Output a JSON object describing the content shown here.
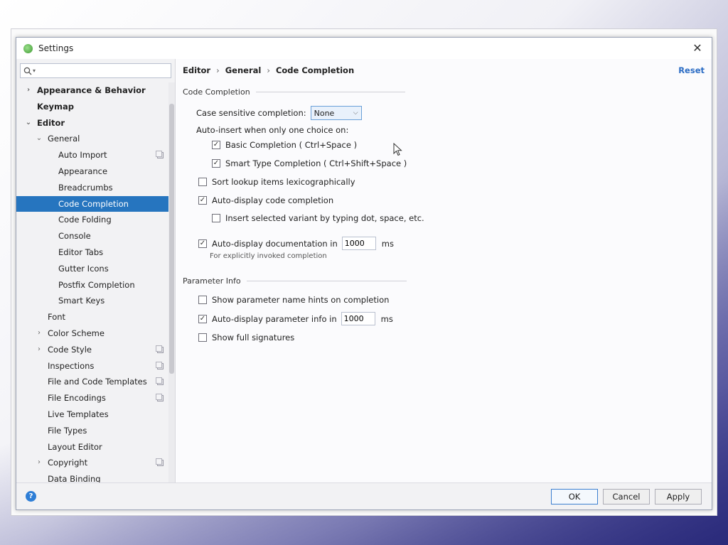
{
  "window": {
    "title": "Settings",
    "close_glyph": "✕",
    "app_icon": "intellij-app-icon"
  },
  "search": {
    "value": "",
    "placeholder": ""
  },
  "tree": [
    {
      "label": "Appearance & Behavior",
      "bold": true,
      "arrow": "›",
      "level": 0
    },
    {
      "label": "Keymap",
      "bold": true,
      "arrow": "",
      "level": 0
    },
    {
      "label": "Editor",
      "bold": true,
      "arrow": "⌄",
      "level": 0
    },
    {
      "label": "General",
      "bold": false,
      "arrow": "⌄",
      "level": 1
    },
    {
      "label": "Auto Import",
      "bold": false,
      "arrow": "",
      "level": 2,
      "copy": true
    },
    {
      "label": "Appearance",
      "bold": false,
      "arrow": "",
      "level": 2
    },
    {
      "label": "Breadcrumbs",
      "bold": false,
      "arrow": "",
      "level": 2
    },
    {
      "label": "Code Completion",
      "bold": false,
      "arrow": "",
      "level": 2,
      "selected": true
    },
    {
      "label": "Code Folding",
      "bold": false,
      "arrow": "",
      "level": 2
    },
    {
      "label": "Console",
      "bold": false,
      "arrow": "",
      "level": 2
    },
    {
      "label": "Editor Tabs",
      "bold": false,
      "arrow": "",
      "level": 2
    },
    {
      "label": "Gutter Icons",
      "bold": false,
      "arrow": "",
      "level": 2
    },
    {
      "label": "Postfix Completion",
      "bold": false,
      "arrow": "",
      "level": 2
    },
    {
      "label": "Smart Keys",
      "bold": false,
      "arrow": "",
      "level": 2
    },
    {
      "label": "Font",
      "bold": false,
      "arrow": "",
      "level": 1
    },
    {
      "label": "Color Scheme",
      "bold": false,
      "arrow": "›",
      "level": 1
    },
    {
      "label": "Code Style",
      "bold": false,
      "arrow": "›",
      "level": 1,
      "copy": true
    },
    {
      "label": "Inspections",
      "bold": false,
      "arrow": "",
      "level": 1,
      "copy": true
    },
    {
      "label": "File and Code Templates",
      "bold": false,
      "arrow": "",
      "level": 1,
      "copy": true
    },
    {
      "label": "File Encodings",
      "bold": false,
      "arrow": "",
      "level": 1,
      "copy": true
    },
    {
      "label": "Live Templates",
      "bold": false,
      "arrow": "",
      "level": 1
    },
    {
      "label": "File Types",
      "bold": false,
      "arrow": "",
      "level": 1
    },
    {
      "label": "Layout Editor",
      "bold": false,
      "arrow": "",
      "level": 1
    },
    {
      "label": "Copyright",
      "bold": false,
      "arrow": "›",
      "level": 1,
      "copy": true
    },
    {
      "label": "Data Binding",
      "bold": false,
      "arrow": "",
      "level": 1
    }
  ],
  "breadcrumb": {
    "items": [
      "Editor",
      "General",
      "Code Completion"
    ],
    "separator": "›"
  },
  "reset_label": "Reset",
  "code_completion": {
    "section_title": "Code Completion",
    "case_sensitive_label": "Case sensitive completion:",
    "case_sensitive_value": "None",
    "auto_insert_label": "Auto-insert when only one choice on:",
    "basic_completion": {
      "label": "Basic Completion ( Ctrl+Space )",
      "checked": true
    },
    "smart_type_completion": {
      "label": "Smart Type Completion ( Ctrl+Shift+Space )",
      "checked": true
    },
    "sort_lexicographically": {
      "label": "Sort lookup items lexicographically",
      "checked": false
    },
    "auto_display_completion": {
      "label": "Auto-display code completion",
      "checked": true
    },
    "insert_selected_variant": {
      "label": "Insert selected variant by typing dot, space, etc.",
      "checked": false
    },
    "auto_display_docs": {
      "label": "Auto-display documentation in",
      "checked": true,
      "value": "1000",
      "unit": "ms"
    },
    "docs_hint": "For explicitly invoked completion"
  },
  "parameter_info": {
    "section_title": "Parameter Info",
    "show_hints": {
      "label": "Show parameter name hints on completion",
      "checked": false
    },
    "auto_display_param": {
      "label": "Auto-display parameter info in",
      "checked": true,
      "value": "1000",
      "unit": "ms"
    },
    "show_full_signatures": {
      "label": "Show full signatures",
      "checked": false
    }
  },
  "footer": {
    "help_glyph": "?",
    "ok_label": "OK",
    "cancel_label": "Cancel",
    "apply_label": "Apply"
  },
  "colors": {
    "selection": "#2675bf",
    "link": "#2b6cc4",
    "help": "#2e7ed6"
  }
}
